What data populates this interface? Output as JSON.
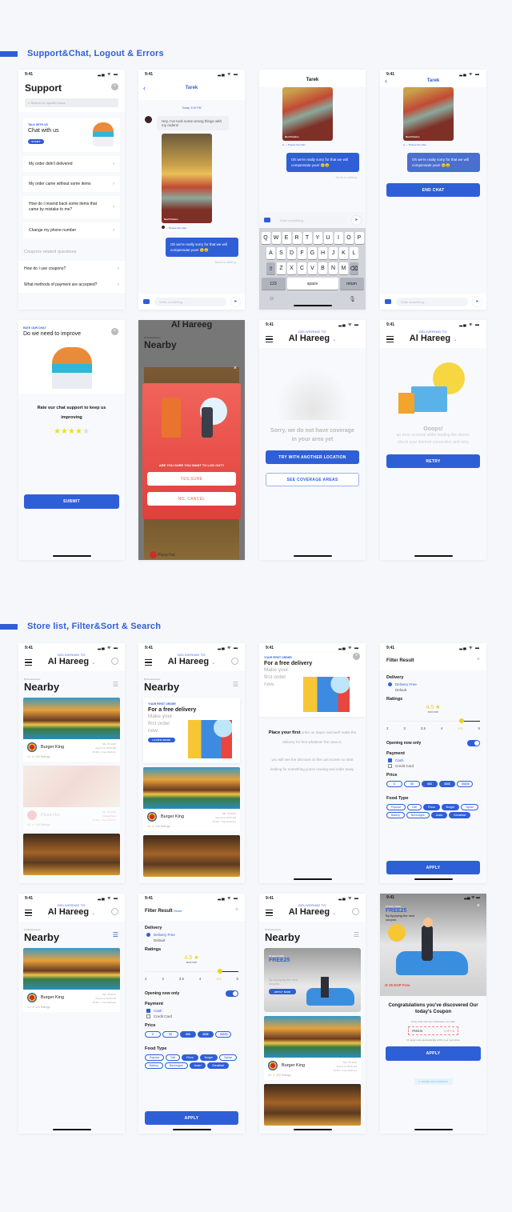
{
  "sections": [
    {
      "title": "Support&Chat, Logout & Errors"
    },
    {
      "title": "Store list, Filter&Sort & Search"
    }
  ],
  "status_time": "9:41",
  "status_icons": "signal wifi battery",
  "colors": {
    "accent": "#2f5fd6",
    "danger": "#e8463f",
    "star": "#e8c921",
    "bg": "#f5f7fb"
  },
  "support": {
    "title": "Support",
    "search_placeholder": "Search for specific issue",
    "chat_card": {
      "label": "TALK WITH US",
      "title": "Chat with us",
      "button": "START"
    },
    "items": [
      "My order didn't delivered",
      "My order came without some items",
      "How do I resend back some items that came by mistake to me?",
      "Change my phone number"
    ],
    "coupons_heading": "Coupons related questions",
    "coupon_items": [
      "How do I use coupons?",
      "What methods of payment are accepted?"
    ]
  },
  "chat": {
    "contact": "Tarek",
    "date": "Today, 9:10 PM",
    "incoming": "Hey, I've took some wrong things with my orders!",
    "photo_caption": "Bad Potatos",
    "photo_meta": "Thanos Sun San",
    "outgoing": "Oh we're really sorry for that we will compensate you!! 😔😑",
    "typing": "Tarek is writing...",
    "input_placeholder": "Write something...",
    "end_chat": "END CHAT"
  },
  "keyboard": {
    "row1": [
      "Q",
      "W",
      "E",
      "R",
      "T",
      "Y",
      "U",
      "I",
      "O",
      "P"
    ],
    "row2": [
      "A",
      "S",
      "D",
      "F",
      "G",
      "H",
      "J",
      "K",
      "L"
    ],
    "row3": [
      "Z",
      "X",
      "C",
      "V",
      "B",
      "N",
      "M"
    ],
    "num": "123",
    "space": "space",
    "ret": "return"
  },
  "rate": {
    "label": "RATE OUR CHAT",
    "title": "Do we need to improve",
    "prompt": "Rate our chat support to keep us improving",
    "rating": 4,
    "rating_max": 5,
    "submit": "SUBMIT"
  },
  "logout": {
    "location": "Al Hareeg",
    "count": "50 Restaurants",
    "heading": "Nearby",
    "question": "ARE YOU SURE YOU WANT TO LOG OUT?",
    "yes": "YES,SURE",
    "no": "NO, CANCEL",
    "peek_store": "Pizza Hut"
  },
  "header": {
    "delivering_label": "DELIVERING TO",
    "location": "Al Hareeg"
  },
  "no_coverage": {
    "message": "Sorry, we do not have coverage in your area yet",
    "primary": "TRY WITH ANOTHER LOCATION",
    "secondary": "SEE COVERAGE AREAS"
  },
  "error": {
    "title": "Ooops!",
    "message": "an error occured while loading the stores, check your internet connection and retry",
    "retry": "RETRY"
  },
  "store_list": {
    "count": "50 Restaurants",
    "heading": "Nearby",
    "stores": [
      {
        "name": "Burger King",
        "rating": "4.1",
        "reviews": "120 Ratings",
        "meta1": "Min. 50 EGP",
        "meta2": "Opens at 10:00 AM",
        "meta3": "30 Min · Free Delivery"
      },
      {
        "name": "Pizza Hut",
        "rating": "4.1",
        "reviews": "120 Ratings",
        "meta1": "Min. 50 EGP",
        "meta2": "Closed Now",
        "meta3": "30 Min · Free Delivery"
      }
    ],
    "search_count": "13 Restaurants"
  },
  "promo": {
    "label": "YOUR FIRST ORDER",
    "title": "For a free delivery",
    "subtitle": "Make your first order now.",
    "button": "LEARN MORE",
    "detail_bold": "Place your first",
    "detail_rest": "order on 3ayez and we'll make the delivery for free whatever the case is.",
    "detail_2": "you will see the discount on the cart screen so start looking for something you're craving and order away."
  },
  "filter": {
    "title": "Filter Result",
    "reset": "Reset",
    "delivery_heading": "Delivery",
    "delivery_options": [
      "Delivery Free",
      "Default"
    ],
    "ratings_heading": "Ratings",
    "rating_value": "4.5",
    "rating_suffix": "and over",
    "rating_ticks": [
      "2",
      "3",
      "3.5",
      "4",
      "4.5",
      "5"
    ],
    "open_now": "Opening now only",
    "open_now_on": true,
    "payment_heading": "Payment",
    "payment_options": [
      {
        "label": "Cash",
        "checked": true
      },
      {
        "label": "Credit Card",
        "checked": false
      }
    ],
    "price_heading": "Price",
    "prices": [
      {
        "label": "$",
        "on": false
      },
      {
        "label": "$$",
        "on": false
      },
      {
        "label": "$$$",
        "on": true
      },
      {
        "label": "$$$$",
        "on": true
      },
      {
        "label": "$$$$$",
        "on": false
      }
    ],
    "food_heading": "Food Type",
    "foods": [
      {
        "label": "Popular",
        "on": false
      },
      {
        "label": "Deli",
        "on": false
      },
      {
        "label": "Pizza",
        "on": true
      },
      {
        "label": "Burger",
        "on": true
      },
      {
        "label": "Syrian",
        "on": false
      },
      {
        "label": "Bakery",
        "on": false
      },
      {
        "label": "Beverages",
        "on": false
      },
      {
        "label": "Asian",
        "on": true
      },
      {
        "label": "Breakfast",
        "on": true
      }
    ],
    "apply": "APPLY"
  },
  "coupon": {
    "label": "25 EGP FREE",
    "code_title": "FREE25",
    "subtitle": "By Applying the new coupon.",
    "button": "APPLY NOW",
    "amount": "25 EGP Free",
    "congrats": "Congratulations you've discovered Our today's Coupon",
    "hint": "Copy code and use it whenever you want",
    "code": "FREE25",
    "copy": "COPY",
    "note": "Or apply code automatically within your next order",
    "apply": "APPLY",
    "share": "SHARE WITH FRIENDS"
  }
}
